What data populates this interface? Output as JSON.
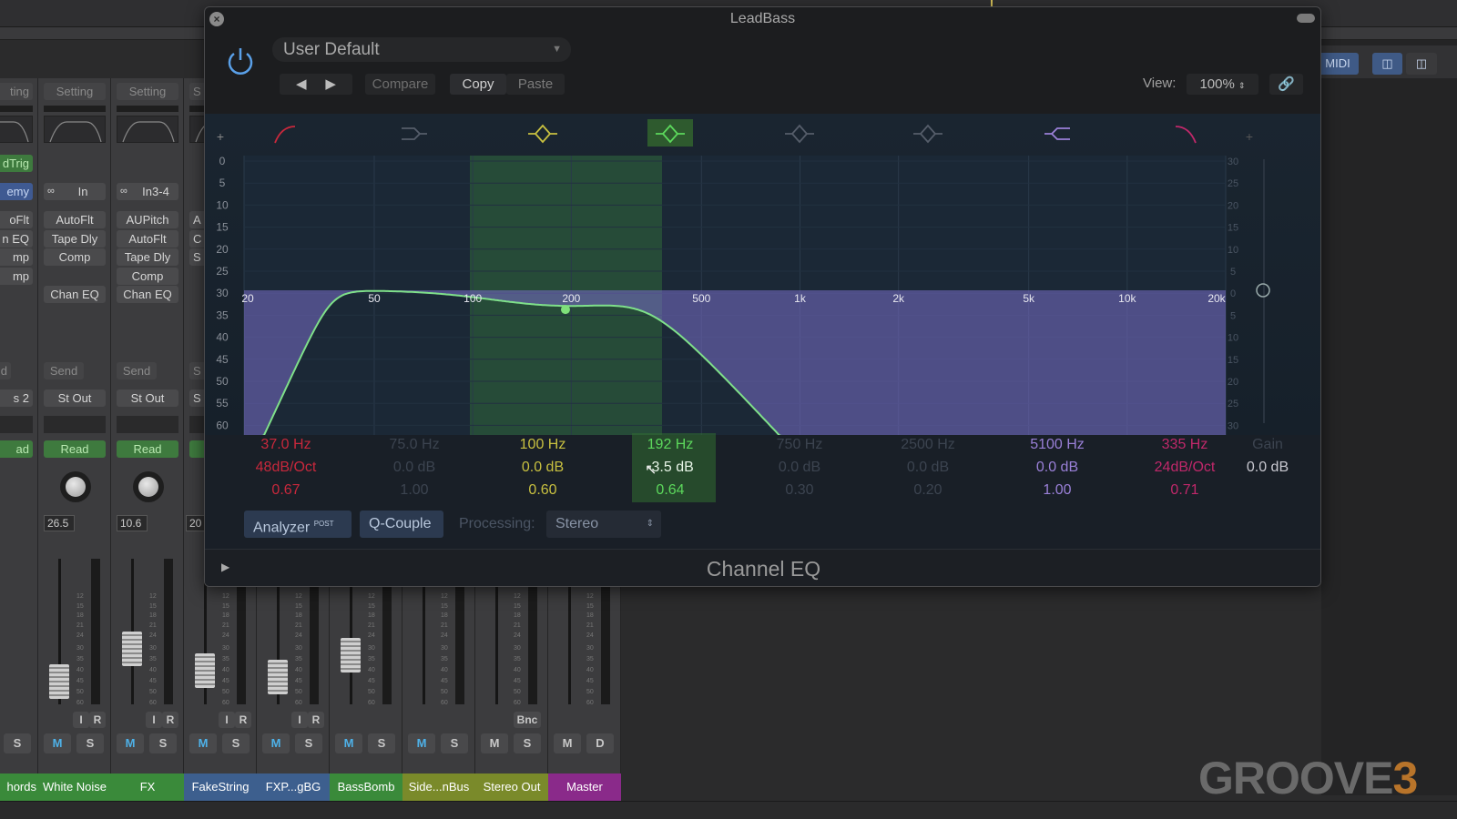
{
  "top": {
    "playhead_color": "#d8c35a"
  },
  "right_panel": {
    "midi_label": "MIDI",
    "view_buttons": [
      "columns-view-icon",
      "split-view-icon"
    ]
  },
  "mixer": {
    "fader_scale": [
      "3",
      "6",
      "9",
      "12",
      "15",
      "18",
      "21",
      "24",
      "30",
      "35",
      "40",
      "45",
      "50",
      "60"
    ],
    "strips": [
      {
        "name": "hords",
        "color": "#3a8a3a",
        "partial": true,
        "setting": "ting",
        "trig": "dTrig",
        "input": "emy",
        "plugins": [
          "oFlt",
          "n EQ",
          "mp",
          "mp"
        ],
        "send": "d",
        "output": "s 2",
        "automation": "ad",
        "mute": "",
        "solo": "S",
        "fader_db": null
      },
      {
        "name": "White Noise",
        "color": "#3a8a3a",
        "setting": "Setting",
        "input": "In",
        "plugins": [
          "AutoFlt",
          "Tape Dly",
          "Comp",
          "",
          "Chan EQ"
        ],
        "send": "Send",
        "output": "St Out",
        "automation": "Read",
        "value": "26.5",
        "input_mon": "I",
        "record": "R",
        "mute": "M",
        "solo": "S",
        "fader_db": -45
      },
      {
        "name": "FX",
        "color": "#3a8a3a",
        "setting": "Setting",
        "input": "In3-4",
        "plugins": [
          "AUPitch",
          "AutoFlt",
          "Tape Dly",
          "Comp",
          "Chan EQ"
        ],
        "send": "Send",
        "output": "St Out",
        "automation": "Read",
        "value": "10.6",
        "input_mon": "I",
        "record": "R",
        "mute": "M",
        "solo": "S",
        "fader_db": -30
      },
      {
        "name": "FakeString",
        "color": "#3d5f8e",
        "setting": "S",
        "plugins": [
          "A",
          "C",
          "S"
        ],
        "send": "S",
        "output": "S",
        "automation": "",
        "value": "20",
        "input_mon": "I",
        "record": "R",
        "mute": "M",
        "solo": "S",
        "fader_db": -40
      },
      {
        "name": "FXP...gBG",
        "color": "#3d5f8e",
        "input_mon": "I",
        "record": "R",
        "mute": "M",
        "solo": "S",
        "fader_db": -43
      },
      {
        "name": "BassBomb",
        "color": "#3a8a3a",
        "mute": "M",
        "solo": "S",
        "fader_db": -33
      },
      {
        "name": "Side...nBus",
        "color": "#7a8a2a",
        "mute": "M",
        "solo": "S",
        "fader_db": -3
      },
      {
        "name": "Stereo Out",
        "color": "#7a8a2a",
        "bounce": "Bnc",
        "mute": "M",
        "solo": "S",
        "fader_db": -3
      },
      {
        "name": "Master",
        "color": "#8a2a8a",
        "mute": "M",
        "solo": "D",
        "fader_db": -3
      }
    ]
  },
  "plugin": {
    "title": "LeadBass",
    "preset": "User Default",
    "compare": "Compare",
    "copy": "Copy",
    "paste": "Paste",
    "view_label": "View:",
    "view_value": "100%",
    "left_scale": [
      "0",
      "5",
      "10",
      "15",
      "20",
      "25",
      "30",
      "35",
      "40",
      "45",
      "50",
      "55",
      "60"
    ],
    "right_scale": [
      "30",
      "25",
      "20",
      "15",
      "10",
      "5",
      "0",
      "5",
      "10",
      "15",
      "20",
      "25",
      "30"
    ],
    "freq_labels": [
      "20",
      "50",
      "100",
      "200",
      "500",
      "1k",
      "2k",
      "5k",
      "10k",
      "20k"
    ],
    "selected_band": 3,
    "bands": [
      {
        "type": "low-cut",
        "freq": "37.0 Hz",
        "gain": "48dB/Oct",
        "q": "0.67",
        "color": "#c8283c",
        "active": true,
        "f": 37,
        "slope": 48
      },
      {
        "type": "low-shelf",
        "freq": "75.0 Hz",
        "gain": "0.0 dB",
        "q": "1.00",
        "color": "#555d6a",
        "active": false
      },
      {
        "type": "bell",
        "freq": "100 Hz",
        "gain": "0.0 dB",
        "q": "0.60",
        "color": "#c8c040",
        "active": true
      },
      {
        "type": "bell",
        "freq": "192 Hz",
        "gain": "-3.5 dB",
        "q": "0.64",
        "color": "#5cd85c",
        "active": true,
        "f": 192,
        "g": -3.5,
        "qv": 0.64
      },
      {
        "type": "bell",
        "freq": "750 Hz",
        "gain": "0.0 dB",
        "q": "0.30",
        "color": "#555d6a",
        "active": false
      },
      {
        "type": "bell",
        "freq": "2500 Hz",
        "gain": "0.0 dB",
        "q": "0.20",
        "color": "#555d6a",
        "active": false
      },
      {
        "type": "high-shelf",
        "freq": "5100 Hz",
        "gain": "0.0 dB",
        "q": "1.00",
        "color": "#9a80d8",
        "active": true
      },
      {
        "type": "high-cut",
        "freq": "335 Hz",
        "gain": "24dB/Oct",
        "q": "0.71",
        "color": "#c0286a",
        "active": true,
        "f": 335,
        "slope": 24
      }
    ],
    "gain_label": "Gain",
    "gain_value": "0.0 dB",
    "analyzer": "Analyzer",
    "analyzer_badge": "POST",
    "qcouple": "Q-Couple",
    "processing_label": "Processing:",
    "processing_value": "Stereo",
    "footer": "Channel EQ"
  },
  "logo": {
    "text": "GROOVE3"
  }
}
